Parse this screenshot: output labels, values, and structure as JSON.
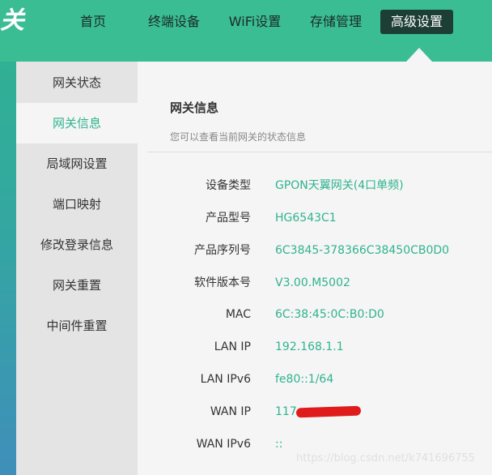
{
  "logo": {
    "text": "关"
  },
  "nav": {
    "items": [
      {
        "label": "首页"
      },
      {
        "label": "终端设备"
      },
      {
        "label": "WiFi设置"
      },
      {
        "label": "存储管理"
      },
      {
        "label": "高级设置"
      }
    ],
    "active_index": 4
  },
  "sidebar": {
    "items": [
      {
        "label": "网关状态"
      },
      {
        "label": "网关信息"
      },
      {
        "label": "局域网设置"
      },
      {
        "label": "端口映射"
      },
      {
        "label": "修改登录信息"
      },
      {
        "label": "网关重置"
      },
      {
        "label": "中间件重置"
      }
    ],
    "active_index": 1
  },
  "main": {
    "title": "网关信息",
    "subtitle": "您可以查看当前网关的状态信息",
    "rows": [
      {
        "label": "设备类型",
        "value": "GPON天翼网关(4口单频)"
      },
      {
        "label": "产品型号",
        "value": "HG6543C1"
      },
      {
        "label": "产品序列号",
        "value": "6C3845-378366C38450CB0D0"
      },
      {
        "label": "软件版本号",
        "value": "V3.00.M5002"
      },
      {
        "label": "MAC",
        "value": "6C:38:45:0C:B0:D0"
      },
      {
        "label": "LAN IP",
        "value": "192.168.1.1"
      },
      {
        "label": "LAN IPv6",
        "value": "fe80::1/64"
      },
      {
        "label": "WAN IP",
        "value": "117"
      },
      {
        "label": "WAN IPv6",
        "value": "::"
      }
    ]
  },
  "watermark": "https://blog.csdn.net/k741696755",
  "colors": {
    "accent": "#2fb38f",
    "topbar": "#3bbd93",
    "nav_active_bg": "#1d3e35",
    "redaction": "#e01b1b"
  }
}
